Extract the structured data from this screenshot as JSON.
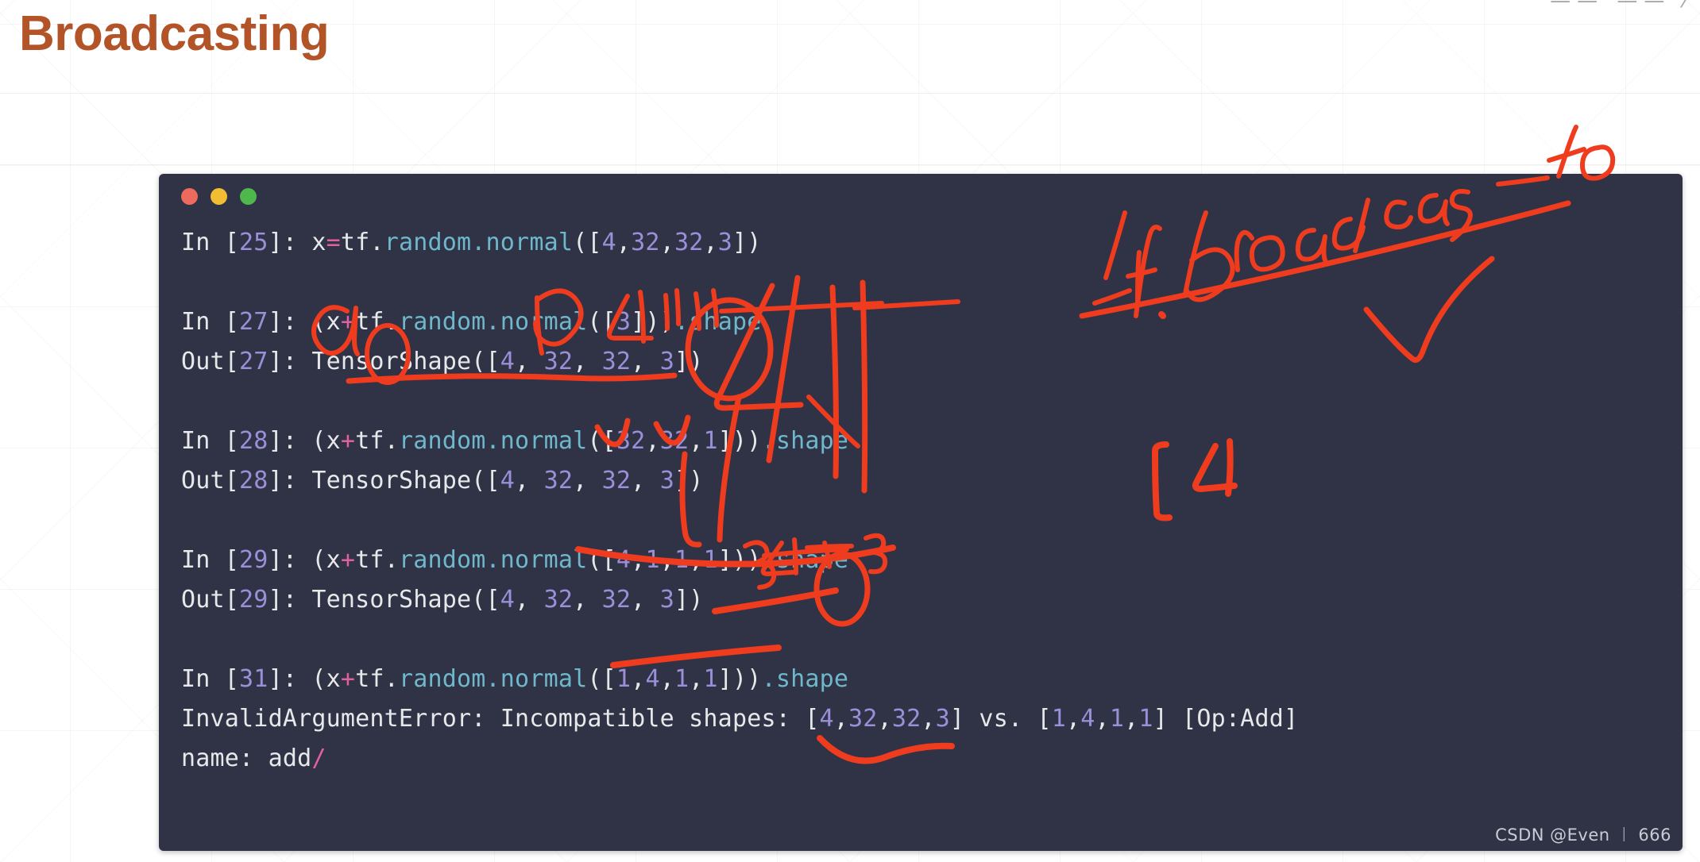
{
  "slide": {
    "title": "Broadcasting",
    "title_color": "#b35328",
    "background_color": "#ffffff"
  },
  "top_right_clipped_glyph": "——  —— ⁄",
  "terminal": {
    "background_color": "#2f3345",
    "window_controls": [
      {
        "name": "close",
        "color": "#ec6a5e"
      },
      {
        "name": "minimize",
        "color": "#f3bd33"
      },
      {
        "name": "zoom",
        "color": "#4fb84c"
      }
    ],
    "syntax_colors": {
      "number": "#9a8fd8",
      "function": "#6fb7cb",
      "operator": "#e0619b",
      "text": "#e7e8ea"
    },
    "lines": [
      {
        "id": "in-25",
        "type": "input",
        "prompt": "In [",
        "prompt_num": "25",
        "prompt_close": "]: ",
        "segments": [
          {
            "t": "x",
            "c": "plain"
          },
          {
            "t": "=",
            "c": "op"
          },
          {
            "t": "tf.",
            "c": "plain"
          },
          {
            "t": "random.normal",
            "c": "fn"
          },
          {
            "t": "([",
            "c": "plain"
          },
          {
            "t": "4",
            "c": "num"
          },
          {
            "t": ",",
            "c": "plain"
          },
          {
            "t": "32",
            "c": "num"
          },
          {
            "t": ",",
            "c": "plain"
          },
          {
            "t": "32",
            "c": "num"
          },
          {
            "t": ",",
            "c": "plain"
          },
          {
            "t": "3",
            "c": "num"
          },
          {
            "t": "])",
            "c": "plain"
          }
        ]
      },
      {
        "id": "blank-1",
        "type": "blank"
      },
      {
        "id": "in-27",
        "type": "input",
        "prompt": "In [",
        "prompt_num": "27",
        "prompt_close": "]: ",
        "segments": [
          {
            "t": "(x",
            "c": "plain"
          },
          {
            "t": "+",
            "c": "op"
          },
          {
            "t": "tf.",
            "c": "plain"
          },
          {
            "t": "random.normal",
            "c": "fn"
          },
          {
            "t": "([",
            "c": "plain"
          },
          {
            "t": "3",
            "c": "num"
          },
          {
            "t": "]))",
            "c": "plain"
          },
          {
            "t": ".shape",
            "c": "fn"
          }
        ]
      },
      {
        "id": "out-27",
        "type": "output",
        "prompt": "Out[",
        "prompt_num": "27",
        "prompt_close": "]: ",
        "segments": [
          {
            "t": "TensorShape([",
            "c": "plain"
          },
          {
            "t": "4",
            "c": "num"
          },
          {
            "t": ", ",
            "c": "plain"
          },
          {
            "t": "32",
            "c": "num"
          },
          {
            "t": ", ",
            "c": "plain"
          },
          {
            "t": "32",
            "c": "num"
          },
          {
            "t": ", ",
            "c": "plain"
          },
          {
            "t": "3",
            "c": "num"
          },
          {
            "t": "])",
            "c": "plain"
          }
        ]
      },
      {
        "id": "blank-2",
        "type": "blank"
      },
      {
        "id": "in-28",
        "type": "input",
        "prompt": "In [",
        "prompt_num": "28",
        "prompt_close": "]: ",
        "segments": [
          {
            "t": "(x",
            "c": "plain"
          },
          {
            "t": "+",
            "c": "op"
          },
          {
            "t": "tf.",
            "c": "plain"
          },
          {
            "t": "random.normal",
            "c": "fn"
          },
          {
            "t": "([",
            "c": "plain"
          },
          {
            "t": "32",
            "c": "num"
          },
          {
            "t": ",",
            "c": "plain"
          },
          {
            "t": "32",
            "c": "num"
          },
          {
            "t": ",",
            "c": "plain"
          },
          {
            "t": "1",
            "c": "num"
          },
          {
            "t": "]))",
            "c": "plain"
          },
          {
            "t": ".shape",
            "c": "fn"
          }
        ]
      },
      {
        "id": "out-28",
        "type": "output",
        "prompt": "Out[",
        "prompt_num": "28",
        "prompt_close": "]: ",
        "segments": [
          {
            "t": "TensorShape([",
            "c": "plain"
          },
          {
            "t": "4",
            "c": "num"
          },
          {
            "t": ", ",
            "c": "plain"
          },
          {
            "t": "32",
            "c": "num"
          },
          {
            "t": ", ",
            "c": "plain"
          },
          {
            "t": "32",
            "c": "num"
          },
          {
            "t": ", ",
            "c": "plain"
          },
          {
            "t": "3",
            "c": "num"
          },
          {
            "t": "])",
            "c": "plain"
          }
        ]
      },
      {
        "id": "blank-3",
        "type": "blank"
      },
      {
        "id": "in-29",
        "type": "input",
        "prompt": "In [",
        "prompt_num": "29",
        "prompt_close": "]: ",
        "segments": [
          {
            "t": "(x",
            "c": "plain"
          },
          {
            "t": "+",
            "c": "op"
          },
          {
            "t": "tf.",
            "c": "plain"
          },
          {
            "t": "random.normal",
            "c": "fn"
          },
          {
            "t": "([",
            "c": "plain"
          },
          {
            "t": "4",
            "c": "num"
          },
          {
            "t": ",",
            "c": "plain"
          },
          {
            "t": "1",
            "c": "num"
          },
          {
            "t": ",",
            "c": "plain"
          },
          {
            "t": "1",
            "c": "num"
          },
          {
            "t": ",",
            "c": "plain"
          },
          {
            "t": "1",
            "c": "num"
          },
          {
            "t": "]))",
            "c": "plain"
          },
          {
            "t": ".shape",
            "c": "fn"
          }
        ]
      },
      {
        "id": "out-29",
        "type": "output",
        "prompt": "Out[",
        "prompt_num": "29",
        "prompt_close": "]: ",
        "segments": [
          {
            "t": "TensorShape([",
            "c": "plain"
          },
          {
            "t": "4",
            "c": "num"
          },
          {
            "t": ", ",
            "c": "plain"
          },
          {
            "t": "32",
            "c": "num"
          },
          {
            "t": ", ",
            "c": "plain"
          },
          {
            "t": "32",
            "c": "num"
          },
          {
            "t": ", ",
            "c": "plain"
          },
          {
            "t": "3",
            "c": "num"
          },
          {
            "t": "])",
            "c": "plain"
          }
        ]
      },
      {
        "id": "blank-4",
        "type": "blank"
      },
      {
        "id": "in-31",
        "type": "input",
        "prompt": "In [",
        "prompt_num": "31",
        "prompt_close": "]: ",
        "segments": [
          {
            "t": "(x",
            "c": "plain"
          },
          {
            "t": "+",
            "c": "op"
          },
          {
            "t": "tf.",
            "c": "plain"
          },
          {
            "t": "random.normal",
            "c": "fn"
          },
          {
            "t": "([",
            "c": "plain"
          },
          {
            "t": "1",
            "c": "num"
          },
          {
            "t": ",",
            "c": "plain"
          },
          {
            "t": "4",
            "c": "num"
          },
          {
            "t": ",",
            "c": "plain"
          },
          {
            "t": "1",
            "c": "num"
          },
          {
            "t": ",",
            "c": "plain"
          },
          {
            "t": "1",
            "c": "num"
          },
          {
            "t": "]))",
            "c": "plain"
          },
          {
            "t": ".shape",
            "c": "fn"
          }
        ]
      },
      {
        "id": "error-line",
        "type": "error",
        "prompt": "",
        "prompt_num": "",
        "prompt_close": "",
        "segments": [
          {
            "t": "InvalidArgumentError: Incompatible shapes: [",
            "c": "plain"
          },
          {
            "t": "4",
            "c": "num"
          },
          {
            "t": ",",
            "c": "plain"
          },
          {
            "t": "32",
            "c": "num"
          },
          {
            "t": ",",
            "c": "plain"
          },
          {
            "t": "32",
            "c": "num"
          },
          {
            "t": ",",
            "c": "plain"
          },
          {
            "t": "3",
            "c": "num"
          },
          {
            "t": "] vs. [",
            "c": "plain"
          },
          {
            "t": "1",
            "c": "num"
          },
          {
            "t": ",",
            "c": "plain"
          },
          {
            "t": "4",
            "c": "num"
          },
          {
            "t": ",",
            "c": "plain"
          },
          {
            "t": "1",
            "c": "num"
          },
          {
            "t": ",",
            "c": "plain"
          },
          {
            "t": "1",
            "c": "num"
          },
          {
            "t": "] [Op:Add]",
            "c": "plain"
          }
        ]
      },
      {
        "id": "error-name",
        "type": "error",
        "prompt": "",
        "prompt_num": "",
        "prompt_close": "",
        "segments": [
          {
            "t": "name: add",
            "c": "plain"
          },
          {
            "t": "/",
            "c": "op"
          }
        ]
      }
    ],
    "watermark": "CSDN @Even ︱ 666"
  },
  "annotations": {
    "ink_color": "#ef3b1e",
    "handwriting": [
      {
        "name": "label-a",
        "text": "a"
      },
      {
        "name": "label-b",
        "text": "b"
      },
      {
        "name": "label-4-dims",
        "text": "4"
      },
      {
        "name": "label-3-exp",
        "text": "3"
      },
      {
        "name": "note-broadcast-to",
        "text": "tf. broadcas_to"
      },
      {
        "name": "note-bracket-4",
        "text": "[ 4"
      },
      {
        "name": "note-32",
        "text": "32"
      }
    ]
  }
}
